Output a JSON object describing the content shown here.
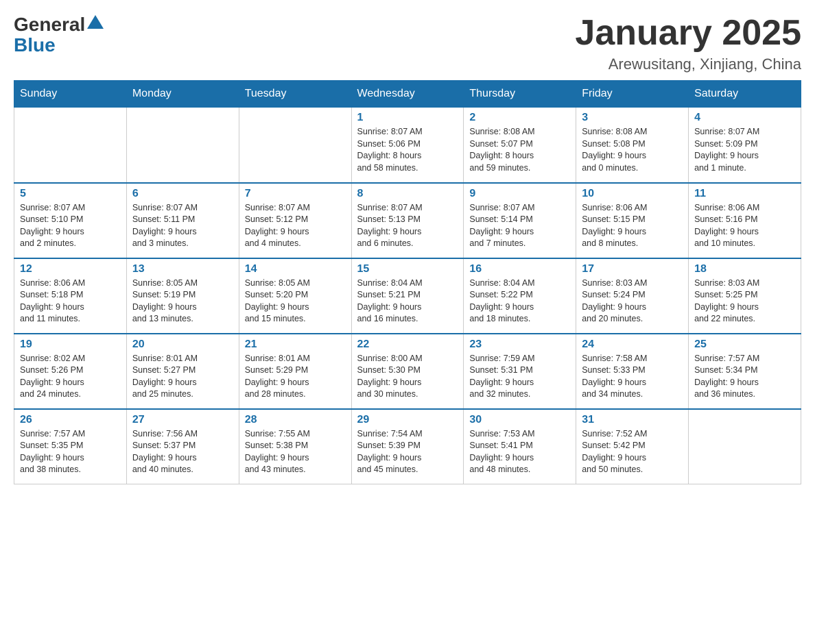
{
  "header": {
    "logo_general": "General",
    "logo_blue": "Blue",
    "month_title": "January 2025",
    "location": "Arewusitang, Xinjiang, China"
  },
  "weekdays": [
    "Sunday",
    "Monday",
    "Tuesday",
    "Wednesday",
    "Thursday",
    "Friday",
    "Saturday"
  ],
  "weeks": [
    [
      {
        "day": "",
        "info": ""
      },
      {
        "day": "",
        "info": ""
      },
      {
        "day": "",
        "info": ""
      },
      {
        "day": "1",
        "info": "Sunrise: 8:07 AM\nSunset: 5:06 PM\nDaylight: 8 hours\nand 58 minutes."
      },
      {
        "day": "2",
        "info": "Sunrise: 8:08 AM\nSunset: 5:07 PM\nDaylight: 8 hours\nand 59 minutes."
      },
      {
        "day": "3",
        "info": "Sunrise: 8:08 AM\nSunset: 5:08 PM\nDaylight: 9 hours\nand 0 minutes."
      },
      {
        "day": "4",
        "info": "Sunrise: 8:07 AM\nSunset: 5:09 PM\nDaylight: 9 hours\nand 1 minute."
      }
    ],
    [
      {
        "day": "5",
        "info": "Sunrise: 8:07 AM\nSunset: 5:10 PM\nDaylight: 9 hours\nand 2 minutes."
      },
      {
        "day": "6",
        "info": "Sunrise: 8:07 AM\nSunset: 5:11 PM\nDaylight: 9 hours\nand 3 minutes."
      },
      {
        "day": "7",
        "info": "Sunrise: 8:07 AM\nSunset: 5:12 PM\nDaylight: 9 hours\nand 4 minutes."
      },
      {
        "day": "8",
        "info": "Sunrise: 8:07 AM\nSunset: 5:13 PM\nDaylight: 9 hours\nand 6 minutes."
      },
      {
        "day": "9",
        "info": "Sunrise: 8:07 AM\nSunset: 5:14 PM\nDaylight: 9 hours\nand 7 minutes."
      },
      {
        "day": "10",
        "info": "Sunrise: 8:06 AM\nSunset: 5:15 PM\nDaylight: 9 hours\nand 8 minutes."
      },
      {
        "day": "11",
        "info": "Sunrise: 8:06 AM\nSunset: 5:16 PM\nDaylight: 9 hours\nand 10 minutes."
      }
    ],
    [
      {
        "day": "12",
        "info": "Sunrise: 8:06 AM\nSunset: 5:18 PM\nDaylight: 9 hours\nand 11 minutes."
      },
      {
        "day": "13",
        "info": "Sunrise: 8:05 AM\nSunset: 5:19 PM\nDaylight: 9 hours\nand 13 minutes."
      },
      {
        "day": "14",
        "info": "Sunrise: 8:05 AM\nSunset: 5:20 PM\nDaylight: 9 hours\nand 15 minutes."
      },
      {
        "day": "15",
        "info": "Sunrise: 8:04 AM\nSunset: 5:21 PM\nDaylight: 9 hours\nand 16 minutes."
      },
      {
        "day": "16",
        "info": "Sunrise: 8:04 AM\nSunset: 5:22 PM\nDaylight: 9 hours\nand 18 minutes."
      },
      {
        "day": "17",
        "info": "Sunrise: 8:03 AM\nSunset: 5:24 PM\nDaylight: 9 hours\nand 20 minutes."
      },
      {
        "day": "18",
        "info": "Sunrise: 8:03 AM\nSunset: 5:25 PM\nDaylight: 9 hours\nand 22 minutes."
      }
    ],
    [
      {
        "day": "19",
        "info": "Sunrise: 8:02 AM\nSunset: 5:26 PM\nDaylight: 9 hours\nand 24 minutes."
      },
      {
        "day": "20",
        "info": "Sunrise: 8:01 AM\nSunset: 5:27 PM\nDaylight: 9 hours\nand 25 minutes."
      },
      {
        "day": "21",
        "info": "Sunrise: 8:01 AM\nSunset: 5:29 PM\nDaylight: 9 hours\nand 28 minutes."
      },
      {
        "day": "22",
        "info": "Sunrise: 8:00 AM\nSunset: 5:30 PM\nDaylight: 9 hours\nand 30 minutes."
      },
      {
        "day": "23",
        "info": "Sunrise: 7:59 AM\nSunset: 5:31 PM\nDaylight: 9 hours\nand 32 minutes."
      },
      {
        "day": "24",
        "info": "Sunrise: 7:58 AM\nSunset: 5:33 PM\nDaylight: 9 hours\nand 34 minutes."
      },
      {
        "day": "25",
        "info": "Sunrise: 7:57 AM\nSunset: 5:34 PM\nDaylight: 9 hours\nand 36 minutes."
      }
    ],
    [
      {
        "day": "26",
        "info": "Sunrise: 7:57 AM\nSunset: 5:35 PM\nDaylight: 9 hours\nand 38 minutes."
      },
      {
        "day": "27",
        "info": "Sunrise: 7:56 AM\nSunset: 5:37 PM\nDaylight: 9 hours\nand 40 minutes."
      },
      {
        "day": "28",
        "info": "Sunrise: 7:55 AM\nSunset: 5:38 PM\nDaylight: 9 hours\nand 43 minutes."
      },
      {
        "day": "29",
        "info": "Sunrise: 7:54 AM\nSunset: 5:39 PM\nDaylight: 9 hours\nand 45 minutes."
      },
      {
        "day": "30",
        "info": "Sunrise: 7:53 AM\nSunset: 5:41 PM\nDaylight: 9 hours\nand 48 minutes."
      },
      {
        "day": "31",
        "info": "Sunrise: 7:52 AM\nSunset: 5:42 PM\nDaylight: 9 hours\nand 50 minutes."
      },
      {
        "day": "",
        "info": ""
      }
    ]
  ]
}
